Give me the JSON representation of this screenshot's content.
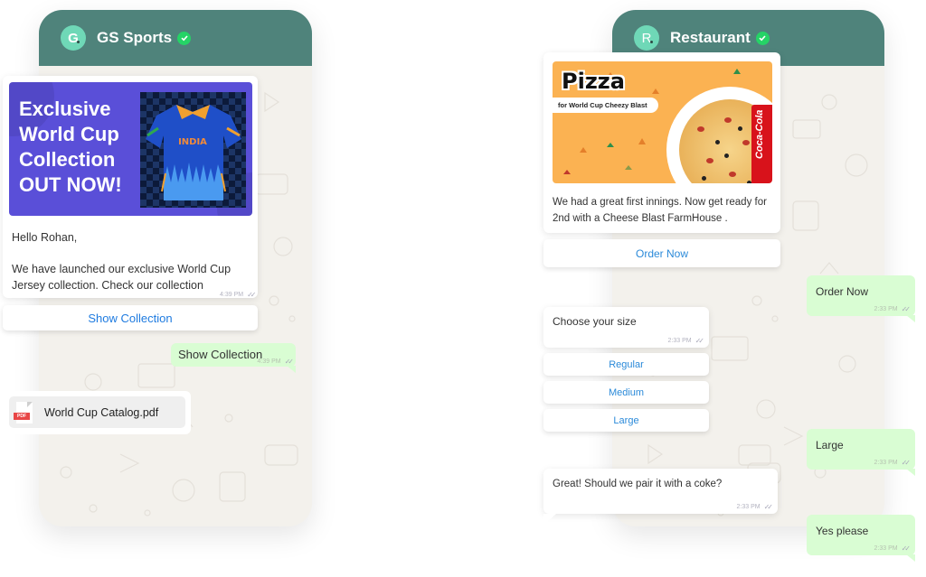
{
  "left_chat": {
    "contact": {
      "initial": "G",
      "name": "GS Sports",
      "verified": true
    },
    "promo": {
      "title_lines": [
        "Exclusive",
        "World Cup",
        "Collection",
        "OUT NOW!"
      ],
      "jersey_text": "INDIA"
    },
    "message": {
      "greeting": "Hello Rohan,",
      "body": "We have launched our exclusive World Cup Jersey collection. Check our collection",
      "time": "4:39 PM"
    },
    "cta_button": "Show Collection",
    "reply": {
      "text": "Show Collection",
      "time": "4:39 PM"
    },
    "attachment": {
      "type_badge": "PDF",
      "filename": "World Cup Catalog.pdf"
    }
  },
  "right_chat": {
    "contact": {
      "initial": "R",
      "name": "Restaurant",
      "verified": true
    },
    "promo": {
      "headline": "Pizza",
      "subline": "for World Cup Cheezy Blast",
      "can_brand": "Coca-Cola"
    },
    "message": {
      "body": "We had a great first innings. Now get ready for 2nd with a Cheese Blast FarmHouse ."
    },
    "cta_button": "Order Now",
    "reply1": {
      "text": "Order Now",
      "time": "2:33 PM"
    },
    "size_prompt": {
      "text": "Choose your size",
      "time": "2:33 PM"
    },
    "size_options": [
      "Regular",
      "Medium",
      "Large"
    ],
    "reply2": {
      "text": "Large",
      "time": "2:33 PM"
    },
    "followup": {
      "text": "Great! Should we pair it with a coke?",
      "time": "2:33 PM"
    },
    "reply3": {
      "text": "Yes please",
      "time": "2:33 PM"
    }
  },
  "colors": {
    "header": "#4f837b",
    "avatar": "#6fd8b7",
    "verified": "#25d366",
    "outgoing_bubble": "#d9fdd3",
    "link_blue": "#2b8ad9",
    "promo_purple": "#5a4fd8",
    "promo_orange": "#fbb252"
  }
}
